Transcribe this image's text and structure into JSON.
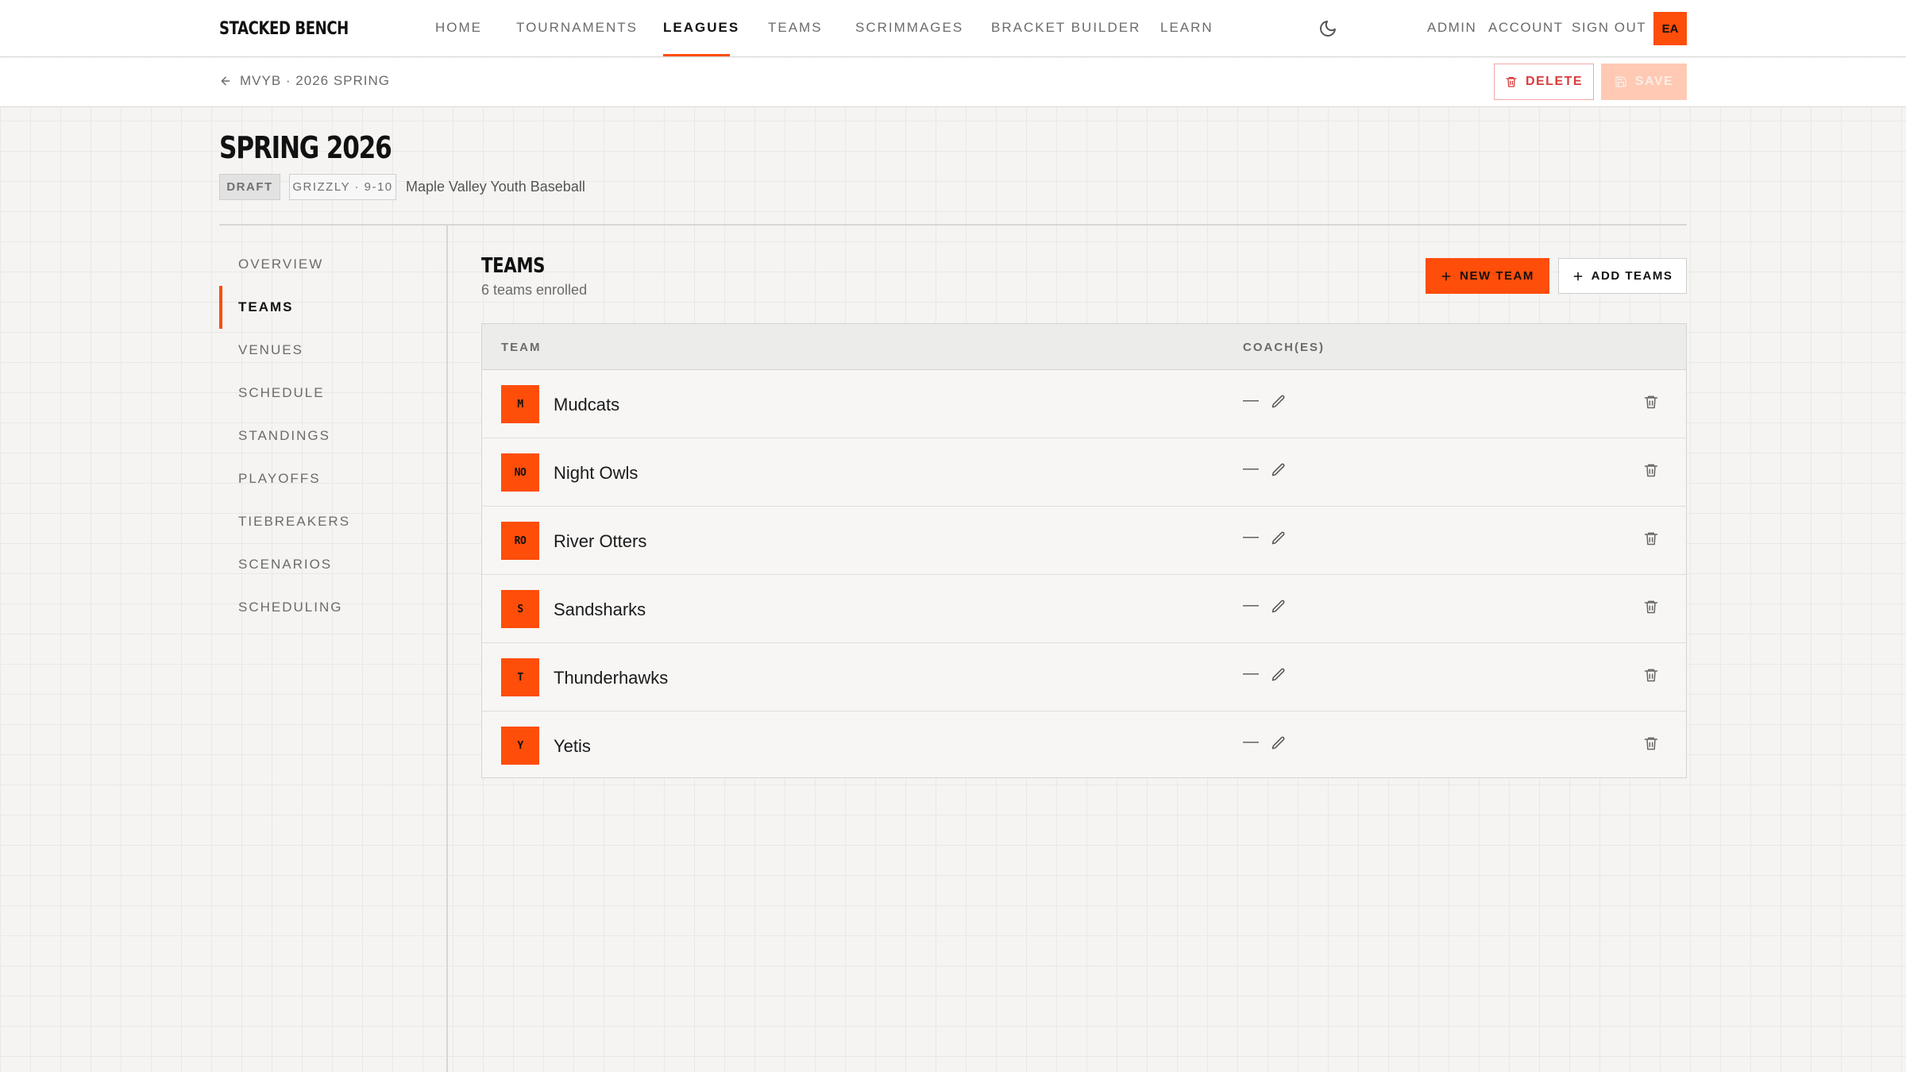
{
  "brand": "STACKED BENCH",
  "nav": {
    "items": [
      "HOME",
      "TOURNAMENTS",
      "LEAGUES",
      "TEAMS",
      "SCRIMMAGES",
      "BRACKET BUILDER",
      "LEARN"
    ],
    "active": "LEAGUES",
    "right": [
      "ADMIN",
      "ACCOUNT",
      "SIGN OUT"
    ],
    "avatar": "EA",
    "theme_icon": "moon-icon"
  },
  "subbar": {
    "breadcrumb": "MVYB · 2026 SPRING",
    "delete_label": "DELETE",
    "save_label": "SAVE"
  },
  "league": {
    "title": "SPRING 2026",
    "status": "DRAFT",
    "division": "GRIZZLY · 9-10",
    "org": "Maple Valley Youth Baseball"
  },
  "sidenav": {
    "items": [
      "OVERVIEW",
      "TEAMS",
      "VENUES",
      "SCHEDULE",
      "STANDINGS",
      "PLAYOFFS",
      "TIEBREAKERS",
      "SCENARIOS",
      "SCHEDULING"
    ],
    "active": "TEAMS"
  },
  "teams_section": {
    "title": "TEAMS",
    "subtitle": "6 teams enrolled",
    "new_team_label": "NEW TEAM",
    "add_teams_label": "ADD TEAMS",
    "columns": [
      "TEAM",
      "COACH(ES)"
    ],
    "rows": [
      {
        "initials": "M",
        "name": "Mudcats",
        "coach": "—"
      },
      {
        "initials": "NO",
        "name": "Night Owls",
        "coach": "—"
      },
      {
        "initials": "RO",
        "name": "River Otters",
        "coach": "—"
      },
      {
        "initials": "S",
        "name": "Sandsharks",
        "coach": "—"
      },
      {
        "initials": "T",
        "name": "Thunderhawks",
        "coach": "—"
      },
      {
        "initials": "Y",
        "name": "Yetis",
        "coach": "—"
      }
    ]
  },
  "colors": {
    "accent": "#ff4d0a",
    "danger": "#d93b3b",
    "save_disabled": "#ffc9b3"
  }
}
